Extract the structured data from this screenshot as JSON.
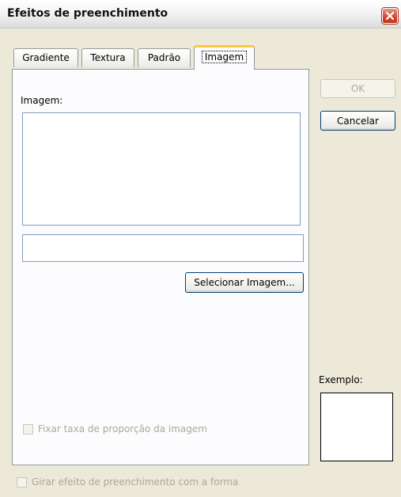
{
  "dialog": {
    "title": "Efeitos de preenchimento"
  },
  "tabs": [
    {
      "label": "Gradiente"
    },
    {
      "label": "Textura"
    },
    {
      "label": "Padrão"
    },
    {
      "label": "Imagem"
    }
  ],
  "image_tab": {
    "image_label": "Imagem:",
    "select_button_label": "Selecionar Imagem...",
    "lock_aspect_label": "Fixar taxa de proporção da imagem"
  },
  "buttons": {
    "ok_label": "OK",
    "cancel_label": "Cancelar"
  },
  "example": {
    "label": "Exemplo:"
  },
  "rotate_with_shape": {
    "label": "Girar efeito de preenchimento com a forma"
  },
  "icons": {
    "close": "close-icon"
  },
  "colors": {
    "close_button": "#d2452a",
    "active_tab_highlight": "#ffc83c"
  }
}
